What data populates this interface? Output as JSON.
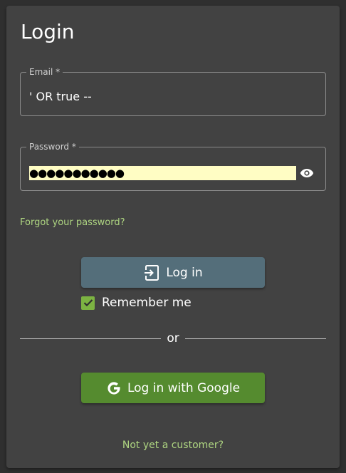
{
  "title": "Login",
  "email": {
    "label": "Email *",
    "value": "' OR true --"
  },
  "password": {
    "label": "Password *",
    "masked_value": "●●●●●●●●●●●"
  },
  "forgot_link": "Forgot your password?",
  "login_button": {
    "label": "Log in",
    "icon": "login-icon"
  },
  "remember_me": {
    "label": "Remember me",
    "checked": true
  },
  "divider_text": "or",
  "google_button": {
    "label": "Log in with Google",
    "icon": "google-icon"
  },
  "signup_link": "Not yet a customer?",
  "colors": {
    "background": "#2f2f2f",
    "card": "#424242",
    "link": "#aed581",
    "primary_button": "#546e7a",
    "google_button": "#558b2f",
    "checkbox": "#7cb342",
    "autofill": "#fffdc4"
  }
}
